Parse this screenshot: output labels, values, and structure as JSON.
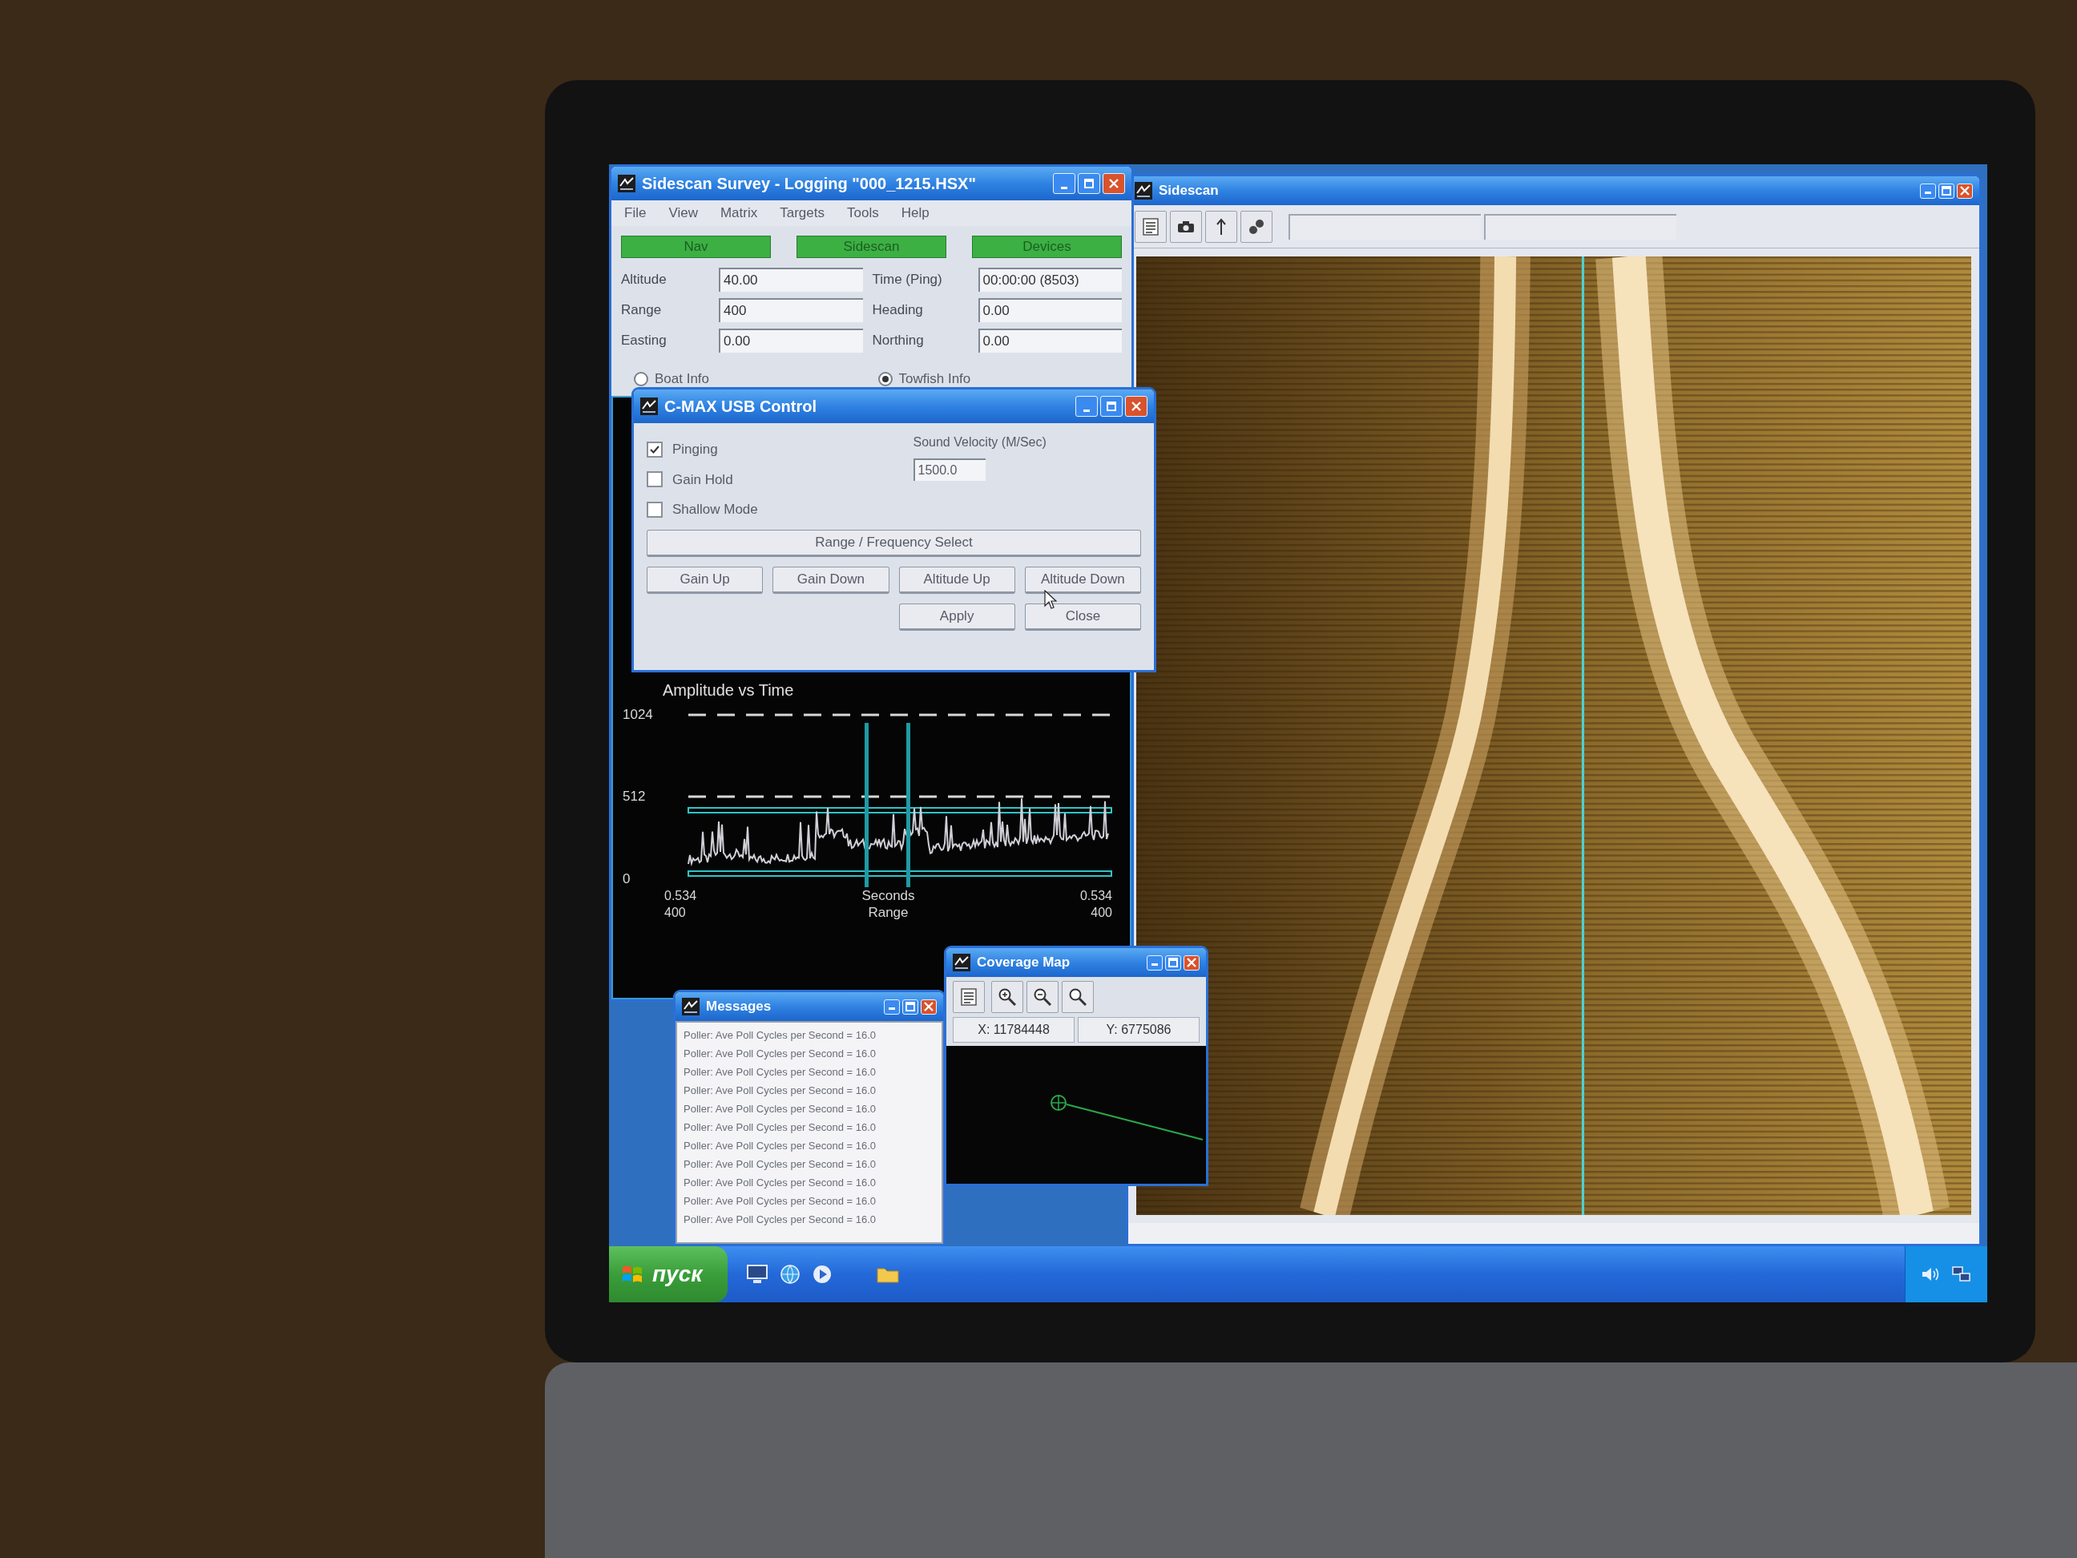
{
  "survey_window": {
    "title": "Sidescan Survey - Logging \"000_1215.HSX\"",
    "menu": [
      "File",
      "View",
      "Matrix",
      "Targets",
      "Tools",
      "Help"
    ],
    "status_buttons": [
      {
        "label": "Nav",
        "on": true
      },
      {
        "label": "Sidescan",
        "on": true
      },
      {
        "label": "Devices",
        "on": true
      }
    ],
    "fields": [
      {
        "label": "Altitude",
        "value": "40.00"
      },
      {
        "label": "Time (Ping)",
        "value": "00:00:00 (8503)"
      },
      {
        "label": "Range",
        "value": "400"
      },
      {
        "label": "Heading",
        "value": "0.00"
      },
      {
        "label": "Easting",
        "value": "0.00"
      },
      {
        "label": "Northing",
        "value": "0.00"
      }
    ],
    "info_options": [
      {
        "label": "Boat Info",
        "selected": false
      },
      {
        "label": "Towfish Info",
        "selected": true
      }
    ],
    "amplitude_plot": {
      "title": "Amplitude vs Time",
      "y_labels": [
        "1024",
        "512",
        "0"
      ],
      "left_values": [
        "0.534",
        "400"
      ],
      "axis_labels": [
        "Seconds",
        "Range"
      ],
      "right_values": [
        "0.534",
        "400"
      ]
    }
  },
  "sidescan_window": {
    "title": "Sidescan"
  },
  "control_window": {
    "title": "C-MAX USB Control",
    "options": [
      {
        "label": "Pinging",
        "checked": true
      },
      {
        "label": "Gain Hold",
        "checked": false
      },
      {
        "label": "Shallow Mode",
        "checked": false
      }
    ],
    "sound_velocity": {
      "label": "Sound Velocity (M/Sec)",
      "value": "1500.0"
    },
    "range_button": "Range / Frequency Select",
    "buttons": [
      "Gain Up",
      "Gain Down",
      "Altitude Up",
      "Altitude Down"
    ],
    "dialog_buttons": [
      "Apply",
      "Close"
    ]
  },
  "messages_window": {
    "title": "Messages",
    "lines": [
      "Poller: Ave Poll Cycles per Second = 16.0",
      "Poller: Ave Poll Cycles per Second = 16.0",
      "Poller: Ave Poll Cycles per Second = 16.0",
      "Poller: Ave Poll Cycles per Second = 16.0",
      "Poller: Ave Poll Cycles per Second = 16.0",
      "Poller: Ave Poll Cycles per Second = 16.0",
      "Poller: Ave Poll Cycles per Second = 16.0",
      "Poller: Ave Poll Cycles per Second = 16.0",
      "Poller: Ave Poll Cycles per Second = 16.0",
      "Poller: Ave Poll Cycles per Second = 16.0",
      "Poller: Ave Poll Cycles per Second = 16.0"
    ]
  },
  "coverage_map": {
    "title": "Coverage Map",
    "x": "X: 11784448",
    "y": "Y: 6775086"
  },
  "taskbar": {
    "start": "пуск"
  }
}
